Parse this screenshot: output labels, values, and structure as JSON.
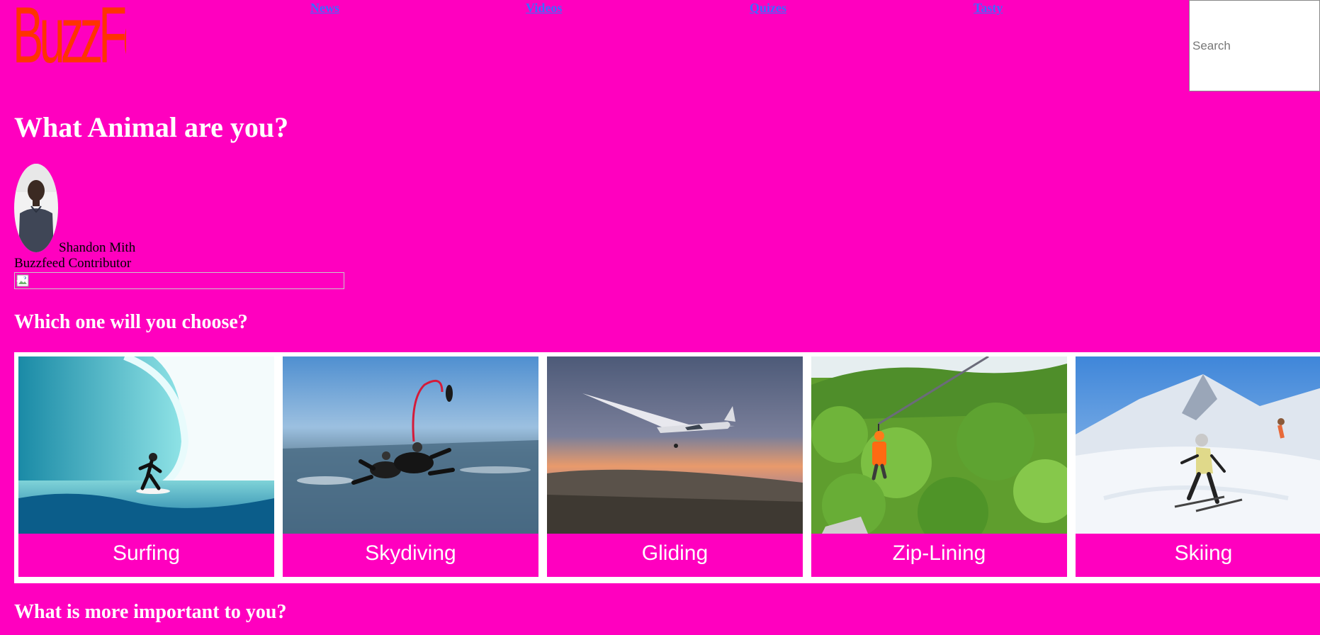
{
  "header": {
    "logo_text": "BuzzFeed",
    "nav": [
      "News",
      "Videos",
      "Quizes",
      "Tasty"
    ],
    "search_placeholder": "Search"
  },
  "quiz": {
    "title": "What Animal are you?",
    "author_name": "Shandon Mith",
    "author_role": "Buzzfeed Contributor"
  },
  "questions": [
    {
      "text": "Which one will you choose?",
      "options": [
        "Surfing",
        "Skydiving",
        "Gliding",
        "Zip-Lining",
        "Skiing"
      ]
    },
    {
      "text": "What is more important to you?"
    }
  ],
  "colors": {
    "background": "#ff00bf",
    "logo": "#ff3300",
    "nav_link": "#3b6cff",
    "heading": "#ffffff"
  }
}
